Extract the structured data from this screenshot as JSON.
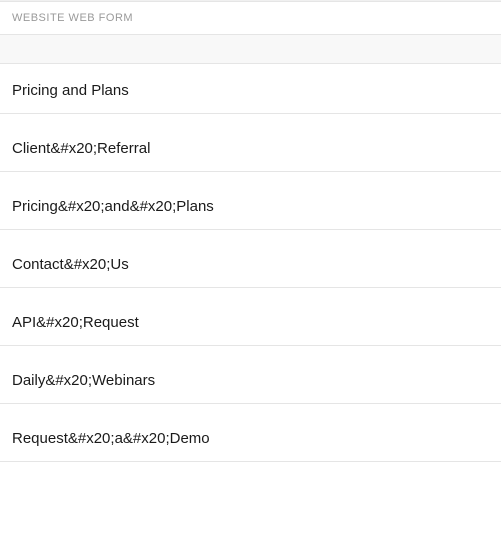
{
  "header": {
    "label": "WEBSITE WEB FORM"
  },
  "currentValue": "Pricing and Plans",
  "options": [
    "Client&#x20;Referral",
    "Pricing&#x20;and&#x20;Plans",
    "Contact&#x20;Us",
    "API&#x20;Request",
    "Daily&#x20;Webinars",
    "Request&#x20;a&#x20;Demo"
  ]
}
